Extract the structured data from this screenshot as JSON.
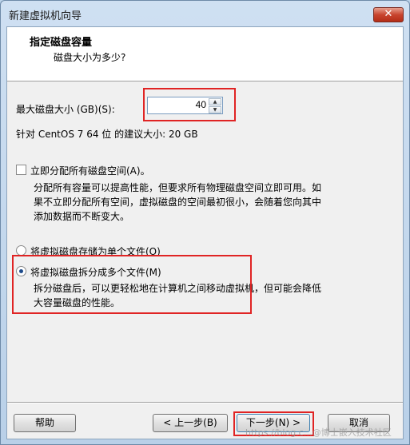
{
  "window": {
    "title": "新建虚拟机向导",
    "close_glyph": "✕"
  },
  "header": {
    "title": "指定磁盘容量",
    "subtitle": "磁盘大小为多少?"
  },
  "disk_size": {
    "label": "最大磁盘大小 (GB)(S):",
    "value": "40",
    "recommend": "针对 CentOS 7 64 位 的建议大小: 20 GB"
  },
  "allocate": {
    "label": "立即分配所有磁盘空间(A)。",
    "checked": false,
    "desc_lines": [
      "分配所有容量可以提高性能，但要求所有物理磁盘空间立即可用。如",
      "果不立即分配所有空间，虚拟磁盘的空间最初很小，会随着您向其中",
      "添加数据而不断变大。"
    ]
  },
  "storage": {
    "single_label": "将虚拟磁盘存储为单个文件(O)",
    "multi_label": "将虚拟磁盘拆分成多个文件(M)",
    "selected": "multi",
    "multi_desc_lines": [
      "拆分磁盘后，可以更轻松地在计算机之间移动虚拟机，但可能会降低",
      "大容量磁盘的性能。"
    ]
  },
  "buttons": {
    "help": "帮助",
    "back": "< 上一步(B)",
    "next": "下一步(N) >",
    "cancel": "取消"
  },
  "watermark": "https://blog.c…@博士嵌入技术社区",
  "colors": {
    "highlight": "#e02424",
    "title_bar": "#bcd3ea",
    "close": "#c8442e"
  }
}
